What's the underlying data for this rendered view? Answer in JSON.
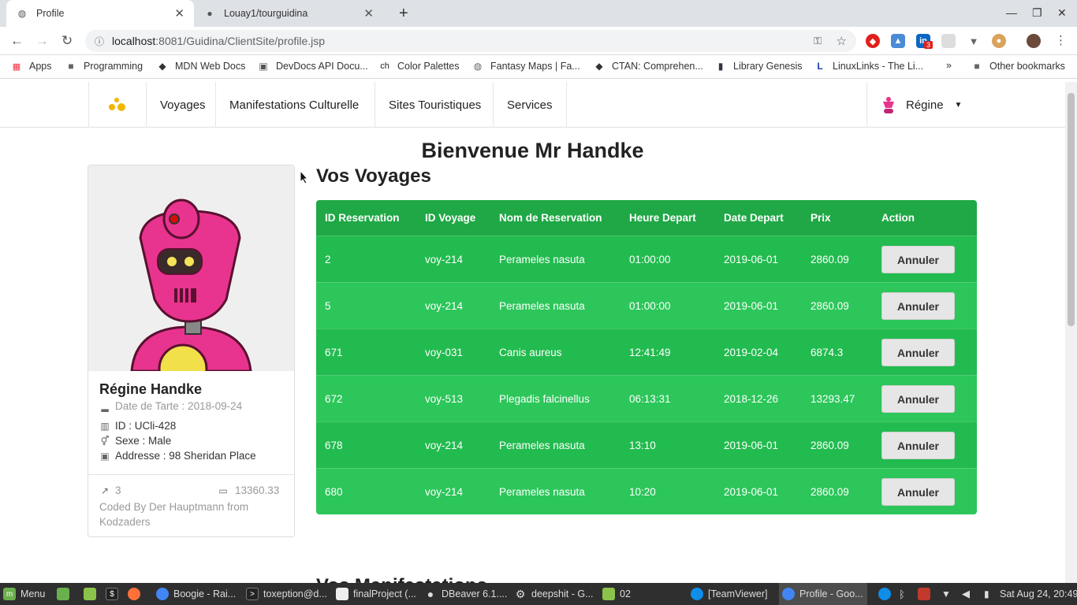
{
  "browser": {
    "tabs": [
      {
        "title": "Profile",
        "icon": "chrome-page-icon"
      },
      {
        "title": "Louay1/tourguidina",
        "icon": "github-icon"
      }
    ],
    "url_host": "localhost",
    "url_path": ":8081/Guidina/ClientSite/profile.jsp",
    "extension_badge": "3",
    "bookmarks": [
      {
        "label": "Apps",
        "icon": "apps-grid-icon"
      },
      {
        "label": "Programming",
        "icon": "folder-icon"
      },
      {
        "label": "MDN Web Docs",
        "icon": "mdn-icon"
      },
      {
        "label": "DevDocs API Docu...",
        "icon": "devdocs-icon"
      },
      {
        "label": "Color Palettes",
        "icon": "ch-icon"
      },
      {
        "label": "Fantasy Maps | Fa...",
        "icon": "globe-icon"
      },
      {
        "label": "CTAN: Comprehen...",
        "icon": "ctan-icon"
      },
      {
        "label": "Library Genesis",
        "icon": "libgen-icon"
      },
      {
        "label": "LinuxLinks - The Li...",
        "icon": "linuxlinks-icon"
      }
    ],
    "more_bookmarks": "»",
    "other_bookmarks": "Other bookmarks"
  },
  "site": {
    "nav": [
      "Voyages",
      "Manifestations Culturelle",
      "Sites Touristiques",
      "Services"
    ],
    "user": "Régine",
    "welcome": "Bienvenue Mr Handke"
  },
  "profile": {
    "name": "Régine Handke",
    "birth": "Date de Tarte : 2018-09-24",
    "id": "ID : UCli-428",
    "sexe": "Sexe : Male",
    "address": "Addresse : 98 Sheridan Place",
    "trips": "3",
    "money": "13360.33",
    "credit": "Coded By Der Hauptmann from Kodzaders"
  },
  "voyages": {
    "title": "Vos Voyages",
    "columns": [
      "ID Reservation",
      "ID Voyage",
      "Nom de Reservation",
      "Heure Depart",
      "Date Depart",
      "Prix",
      "Action"
    ],
    "rows": [
      [
        "2",
        "voy-214",
        "Perameles nasuta",
        "01:00:00",
        "2019-06-01",
        "2860.09",
        "Annuler"
      ],
      [
        "5",
        "voy-214",
        "Perameles nasuta",
        "01:00:00",
        "2019-06-01",
        "2860.09",
        "Annuler"
      ],
      [
        "671",
        "voy-031",
        "Canis aureus",
        "12:41:49",
        "2019-02-04",
        "6874.3",
        "Annuler"
      ],
      [
        "672",
        "voy-513",
        "Plegadis falcinellus",
        "06:13:31",
        "2018-12-26",
        "13293.47",
        "Annuler"
      ],
      [
        "678",
        "voy-214",
        "Perameles nasuta",
        "13:10",
        "2019-06-01",
        "2860.09",
        "Annuler"
      ],
      [
        "680",
        "voy-214",
        "Perameles nasuta",
        "10:20",
        "2019-06-01",
        "2860.09",
        "Annuler"
      ]
    ]
  },
  "next_section": "Vos Manifestations",
  "taskbar": {
    "menu": "Menu",
    "items": [
      "Boogie - Rai...",
      "toxeption@d...",
      "finalProject (...",
      "DBeaver 6.1....",
      "deepshit - G...",
      "02",
      "[TeamViewer]",
      "Profile - Goo..."
    ],
    "clock": "Sat Aug 24, 20:49"
  },
  "colors": {
    "table_header": "#1fa845",
    "table_row": "#22bb4f",
    "accent_pink": "#e8348e"
  }
}
